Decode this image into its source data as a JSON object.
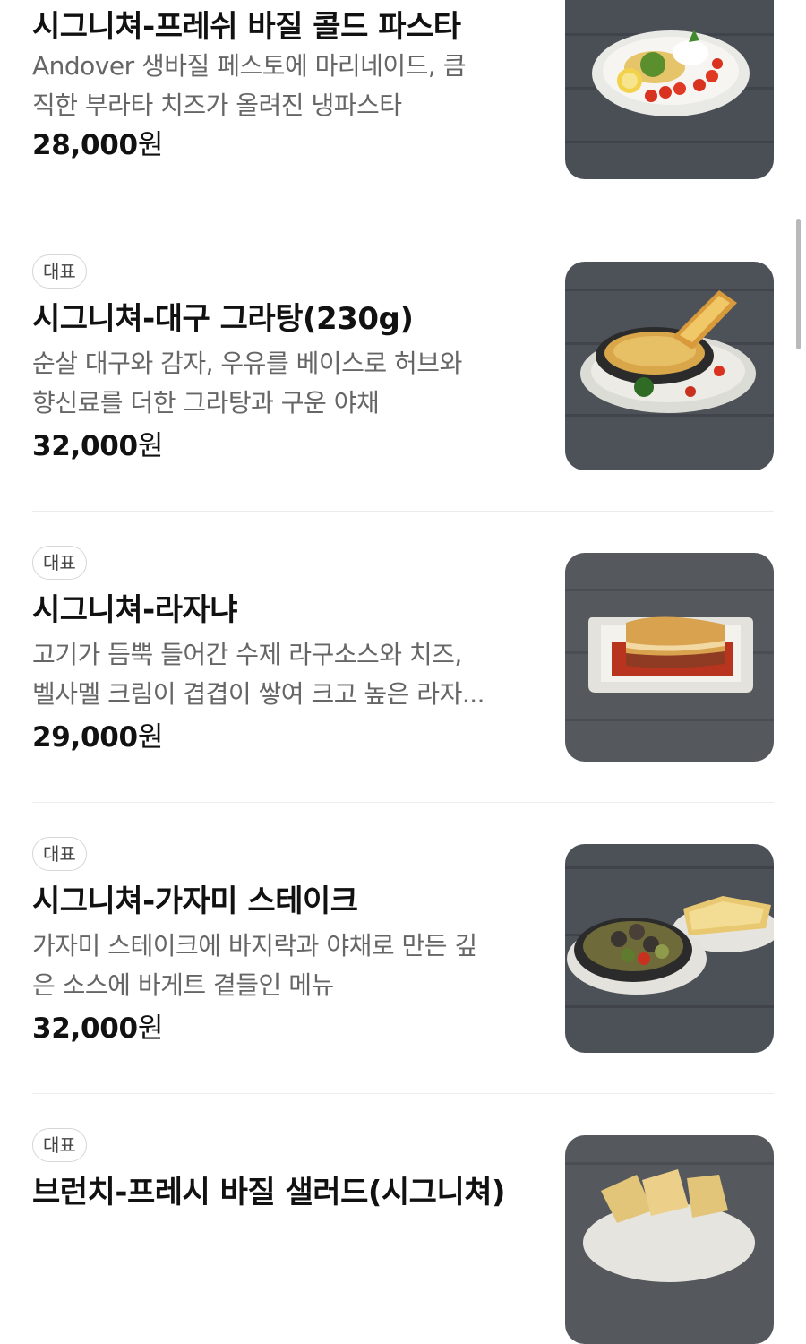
{
  "items": [
    {
      "badge": "",
      "name": "시그니쳐-프레쉬 바질 콜드 파스타",
      "desc1": "Andover 생바질 페스토에 마리네이드, 큼",
      "desc2": "직한 부라타 치즈가 올려진 냉파스타",
      "price": "28,000",
      "currency": "원",
      "image": "cold-basil-pasta-photo"
    },
    {
      "badge": "대표",
      "name": "시그니쳐-대구 그라탕(230g)",
      "desc1": "순살 대구와 감자, 우유를 베이스로 허브와",
      "desc2": "향신료를 더한 그라탕과 구운 야채",
      "price": "32,000",
      "currency": "원",
      "image": "cod-gratin-photo"
    },
    {
      "badge": "대표",
      "name": "시그니쳐-라자냐",
      "desc1": "고기가 듬뿍 들어간 수제 라구소스와 치즈,",
      "desc2": "벨사멜 크림이 겹겹이 쌓여 크고 높은 라자...",
      "price": "29,000",
      "currency": "원",
      "image": "lasagna-photo"
    },
    {
      "badge": "대표",
      "name": "시그니쳐-가자미 스테이크",
      "desc1": "가자미 스테이크에 바지락과 야채로 만든 깊",
      "desc2": "은 소스에 바게트 곁들인 메뉴",
      "price": "32,000",
      "currency": "원",
      "image": "flounder-steak-photo"
    },
    {
      "badge": "대표",
      "name": "브런치-프레시 바질 샐러드(시그니쳐)",
      "desc1": "",
      "desc2": "",
      "price": "",
      "currency": "",
      "image": "basil-salad-photo"
    }
  ],
  "colors": {
    "text": "#111111",
    "desc": "#666666",
    "badge_border": "#d6d6d6",
    "divider": "#ececec",
    "photo_background": "#4a4e55"
  }
}
